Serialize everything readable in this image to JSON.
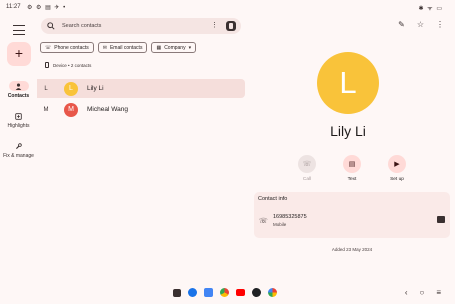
{
  "status_bar": {
    "time": "11:27",
    "left_icons": "⚙ ⚙ ▤ ✈ •",
    "right_icons": "✱ ᯤ ▭"
  },
  "nav_rail": {
    "items": [
      {
        "label": "Contacts",
        "icon": "person-icon",
        "active": true
      },
      {
        "label": "Highlights",
        "icon": "highlights-icon",
        "active": false
      },
      {
        "label": "Fix & manage",
        "icon": "wrench-icon",
        "active": false
      }
    ],
    "fab_label": "+"
  },
  "search": {
    "placeholder": "Search contacts",
    "more": "⋮"
  },
  "filters": [
    {
      "label": "Phone contacts",
      "icon": "phone-icon"
    },
    {
      "label": "Email contacts",
      "icon": "mail-icon"
    },
    {
      "label": "Company",
      "icon": "company-icon",
      "dropdown": "▾"
    }
  ],
  "device_line": "Device • 2 contacts",
  "contacts": [
    {
      "section_letter": "L",
      "initial": "L",
      "name": "Lily Li",
      "color": "#f9c33a",
      "selected": true
    },
    {
      "section_letter": "M",
      "initial": "M",
      "name": "Micheal Wang",
      "color": "#e8574a",
      "selected": false
    }
  ],
  "header_icons": {
    "edit": "✎",
    "star": "☆",
    "more": "⋮"
  },
  "detail": {
    "initial": "L",
    "name": "Lily Li",
    "avatar_color": "#f9c33a",
    "actions": [
      {
        "label": "Call",
        "icon": "☏",
        "enabled": false
      },
      {
        "label": "Text",
        "icon": "▤",
        "enabled": true
      },
      {
        "label": "Set up",
        "icon": "▶",
        "enabled": true
      }
    ],
    "contact_info_title": "Contact info",
    "phone": "16985325875",
    "phone_type": "Mobile",
    "added": "Added 23 May 2024"
  },
  "dock_apps": [
    {
      "name": "app-grid",
      "color": "#3a3030"
    },
    {
      "name": "messages",
      "color": "#1a73e8"
    },
    {
      "name": "files",
      "color": "#4285f4"
    },
    {
      "name": "chrome",
      "color": "#ea4335"
    },
    {
      "name": "youtube",
      "color": "#ff0000"
    },
    {
      "name": "camera",
      "color": "#202124"
    },
    {
      "name": "photos",
      "color": "#fbbc04"
    }
  ],
  "nav_buttons": {
    "back": "‹",
    "home": "○",
    "recents": "≡"
  }
}
